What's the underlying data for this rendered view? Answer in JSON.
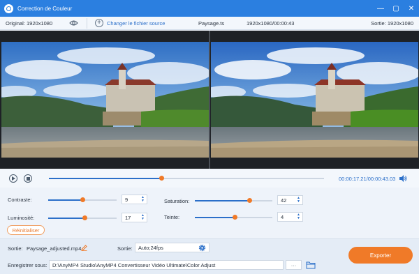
{
  "window": {
    "title": "Correction de Couleur",
    "controls": [
      "—",
      "▢",
      "✕"
    ]
  },
  "infobar": {
    "original": "Original: 1920x1080",
    "change_source": "Changer le fichier source",
    "file_name": "Paysage.ts",
    "resolution_duration": "1920x1080/00:00:43",
    "output": "Sortie: 1920x1080"
  },
  "playback": {
    "time": "00:00:17.21/00:00:43.03",
    "progress": 0.41
  },
  "adjust": {
    "contrast": {
      "label": "Contraste:",
      "value": "9",
      "level": 0.51
    },
    "saturation": {
      "label": "Saturation:",
      "value": "42",
      "level": 0.71
    },
    "brightness": {
      "label": "Luminosité:",
      "value": "17",
      "level": 0.54
    },
    "hue": {
      "label": "Teinte:",
      "value": "4",
      "level": 0.52
    },
    "reset_label": "Réinitialiser"
  },
  "bottom": {
    "output_label": "Sortie:",
    "output_file": "Paysage_adjusted.mp4",
    "format_label": "Sortie:",
    "format_value": "Auto;24fps",
    "save_label": "Enregistrer sous:",
    "save_path": "D:\\AnyMP4 Studio\\AnyMP4 Convertisseur Vidéo Ultimate\\Color Adjust",
    "browse_label": "···",
    "export_label": "Exporter"
  },
  "colors": {
    "accent": "#2b7fe0",
    "orange": "#f07a28",
    "blue_text": "#2b6fc9"
  }
}
